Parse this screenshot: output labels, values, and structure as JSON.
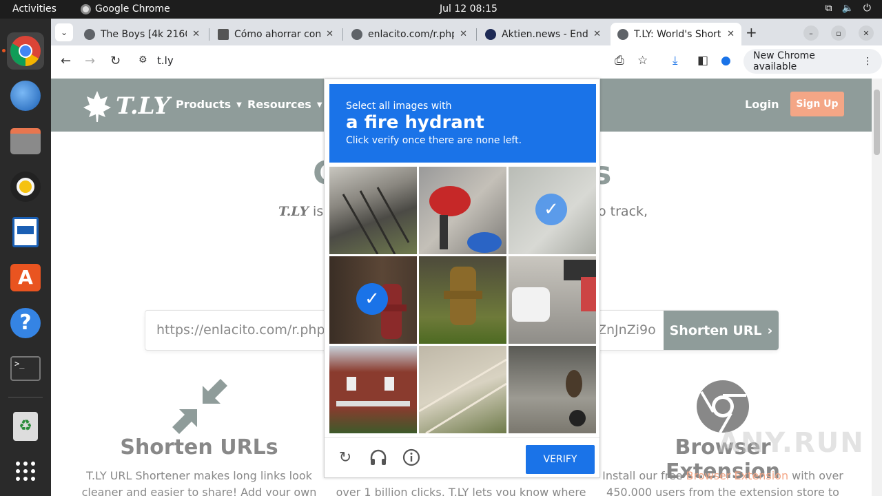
{
  "os": {
    "activities": "Activities",
    "app_name": "Google Chrome",
    "clock": "Jul 12  08:15"
  },
  "browser": {
    "tabs": [
      {
        "title": "The Boys [4k 2160p"
      },
      {
        "title": "Cómo ahorrar con"
      },
      {
        "title": "enlacito.com/r.php"
      },
      {
        "title": "Aktien.news - End"
      },
      {
        "title": "T.LY: World's Short"
      }
    ],
    "address": "t.ly",
    "update_label": "New Chrome available"
  },
  "site": {
    "logo_text": "T.LY",
    "nav": {
      "products": "Products",
      "resources": "Resources",
      "login": "Login",
      "signup": "Sign Up"
    },
    "hero_title_left": "C",
    "hero_title_right": "s",
    "hero_sub_brand": "T.LY",
    "hero_sub_left": " is t",
    "hero_sub_right": "o track,",
    "url_value": "https://enlacito.com/r.php?",
    "url_tail": "ZnJnZi9o",
    "shorten_label": "Shorten URL",
    "features": [
      {
        "title": "Shorten URLs",
        "line1": "T.LY URL Shortener makes long links look",
        "line2": "cleaner and easier to share! Add your own"
      },
      {
        "line2": "over 1 billion clicks, T.LY lets you know where"
      },
      {
        "title": "Browser Extension",
        "line1_a": "Install our free ",
        "line1_link": "Browser Extension",
        "line1_b": " with over",
        "line2": "450,000 users from the extension store to"
      }
    ]
  },
  "captcha": {
    "prompt_line1": "Select all images with",
    "prompt_target": "a fire hydrant",
    "prompt_line3": "Click verify once there are none left.",
    "verify_label": "VERIFY",
    "tiles": [
      {
        "name": "stairs",
        "selected": false
      },
      {
        "name": "motorcycle",
        "selected": false
      },
      {
        "name": "hydrant-faded",
        "selected": true
      },
      {
        "name": "hydrant-red",
        "selected": true
      },
      {
        "name": "hydrant-rusty",
        "selected": false
      },
      {
        "name": "cars-street",
        "selected": false
      },
      {
        "name": "house",
        "selected": false
      },
      {
        "name": "stairs-railing",
        "selected": false
      },
      {
        "name": "motorbike-rider",
        "selected": false
      }
    ]
  },
  "watermark": "ANY.RUN"
}
